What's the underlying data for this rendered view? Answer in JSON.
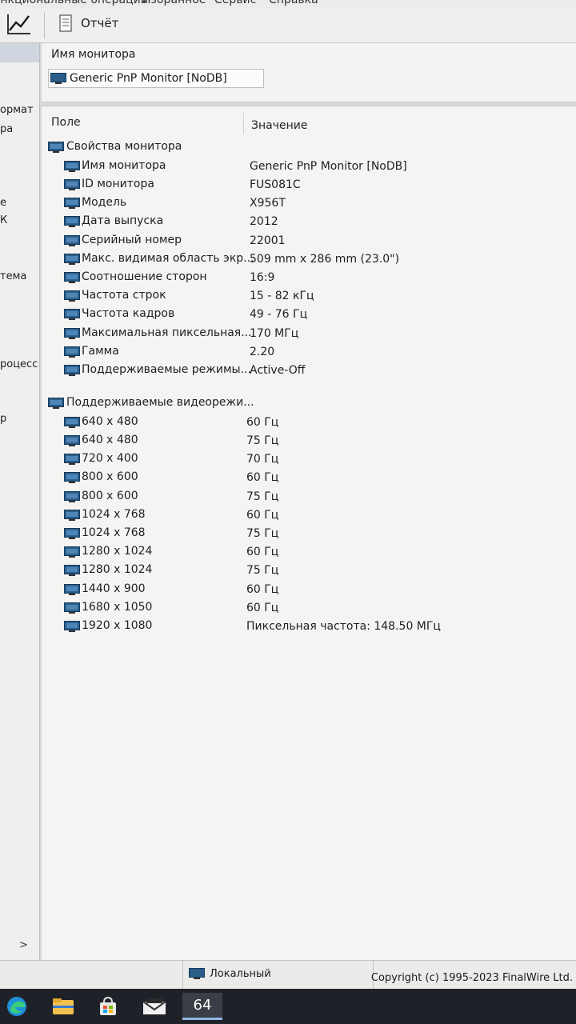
{
  "menu": {
    "items": [
      "Функциональные операции",
      "Избранное",
      "Сервис",
      "Справка"
    ]
  },
  "toolbar": {
    "chart_icon": "line-chart-icon",
    "report_icon": "document-icon",
    "report_label": "Отчёт"
  },
  "left_panel": {
    "fragments": [
      "ормат",
      "ра",
      "е",
      "К",
      "тема",
      "роцесс",
      "р"
    ],
    "expand_glyph": ">"
  },
  "monitor_header": {
    "title": "Имя монитора",
    "selected": "Generic PnP Monitor [NoDB]"
  },
  "columns": {
    "field": "Поле",
    "value": "Значение"
  },
  "groups": [
    {
      "name": "Свойства монитора",
      "rows": [
        {
          "field": "Имя монитора",
          "value": "Generic PnP Monitor [NoDB]"
        },
        {
          "field": "ID монитора",
          "value": "FUS081C"
        },
        {
          "field": "Модель",
          "value": "X956T"
        },
        {
          "field": "Дата выпуска",
          "value": "2012"
        },
        {
          "field": "Серийный номер",
          "value": "22001"
        },
        {
          "field": "Макс. видимая область экр...",
          "value": "509 mm x 286 mm (23.0\")"
        },
        {
          "field": "Соотношение сторон",
          "value": "16:9"
        },
        {
          "field": "Частота строк",
          "value": "15 - 82 кГц"
        },
        {
          "field": "Частота кадров",
          "value": "49 - 76 Гц"
        },
        {
          "field": "Максимальная пиксельная...",
          "value": "170 МГц"
        },
        {
          "field": "Гамма",
          "value": "2.20"
        },
        {
          "field": "Поддерживаемые режимы...",
          "value": "Active-Off"
        }
      ]
    },
    {
      "name": "Поддерживаемые видеорежи...",
      "rows": [
        {
          "field": "640 x 480",
          "value": "60 Гц"
        },
        {
          "field": "640 x 480",
          "value": "75 Гц"
        },
        {
          "field": "720 x 400",
          "value": "70 Гц"
        },
        {
          "field": "800 x 600",
          "value": "60 Гц"
        },
        {
          "field": "800 x 600",
          "value": "75 Гц"
        },
        {
          "field": "1024 x 768",
          "value": "60 Гц"
        },
        {
          "field": "1024 x 768",
          "value": "75 Гц"
        },
        {
          "field": "1280 x 1024",
          "value": "60 Гц"
        },
        {
          "field": "1280 x 1024",
          "value": "75 Гц"
        },
        {
          "field": "1440 x 900",
          "value": "60 Гц"
        },
        {
          "field": "1680 x 1050",
          "value": "60 Гц"
        },
        {
          "field": "1920 x 1080",
          "value": "Пиксельная частота: 148.50 МГц"
        }
      ]
    }
  ],
  "status_bar": {
    "local_label": "Локальный",
    "copyright": "Copyright (c) 1995-2023 FinalWire Ltd."
  },
  "taskbar": {
    "icons": [
      "edge-browser-icon",
      "file-explorer-icon",
      "store-icon",
      "mail-icon",
      "aida64-icon"
    ],
    "active_label": "64"
  },
  "colors": {
    "monitor_icon": "#2b5d8a",
    "taskbar": "#1e2228"
  }
}
